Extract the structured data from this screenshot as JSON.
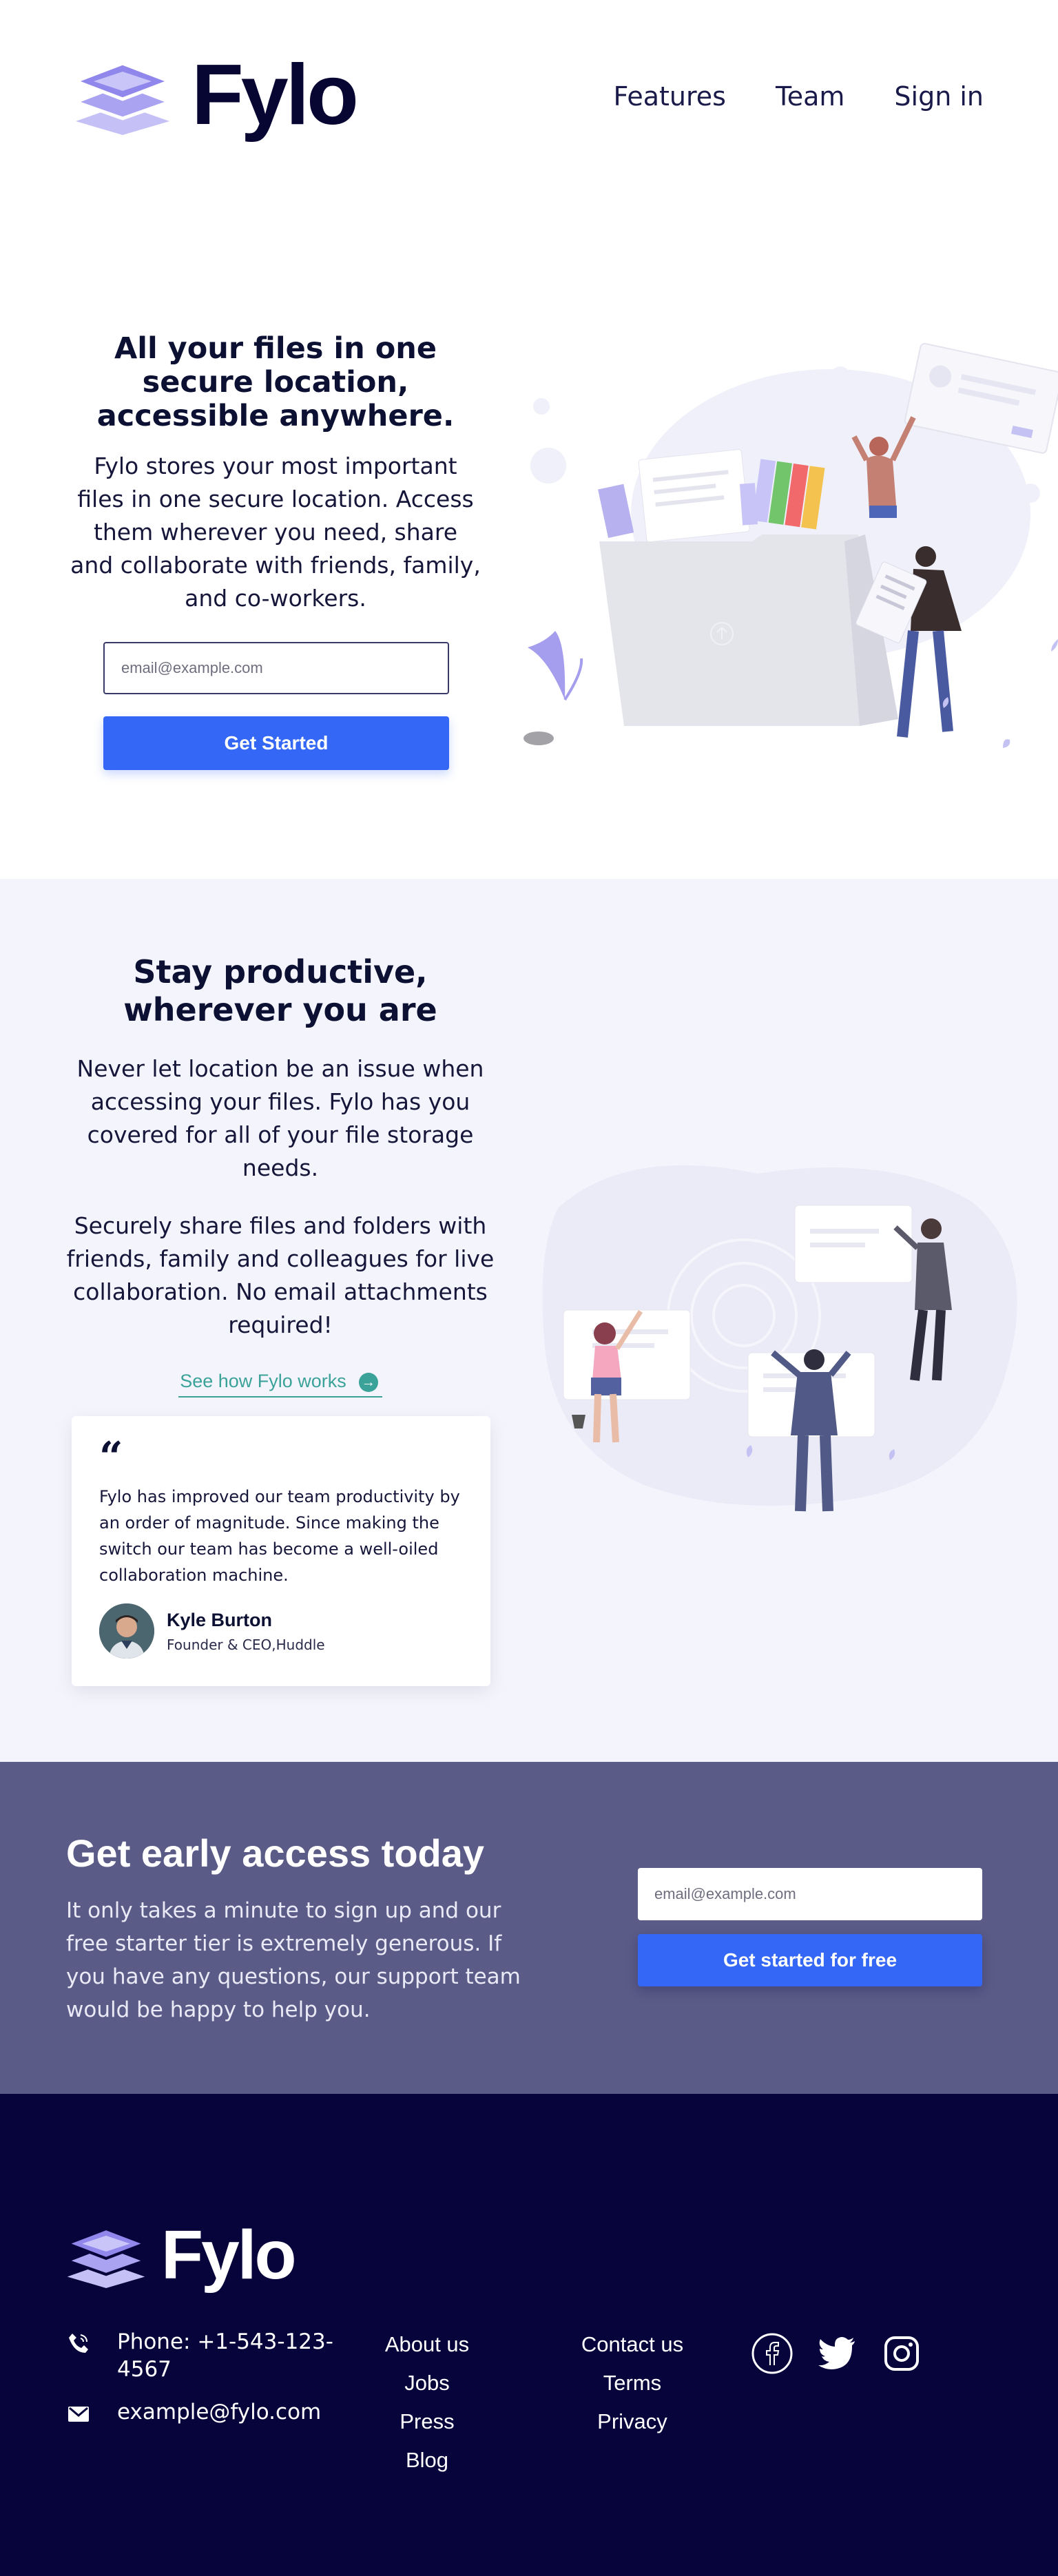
{
  "brand": {
    "name": "Fylo",
    "accent": "#3467f6",
    "link_color": "#3ba29a",
    "dark_navy": "#07043b",
    "muted_purple": "#5b5b88"
  },
  "nav": {
    "items": [
      "Features",
      "Team",
      "Sign in"
    ]
  },
  "hero": {
    "title": "All your files in one secure location, accessible anywhere.",
    "description": "Fylo stores your most important files in one secure location. Access them wherever you need, share and collaborate with friends, family, and co-workers.",
    "email_placeholder": "email@example.com",
    "cta_label": "Get Started"
  },
  "productive": {
    "title": "Stay productive, wherever you are",
    "para1": "Never let location be an issue when accessing your files. Fylo has you covered for all of your file storage needs.",
    "para2": "Securely share files and folders with friends, family and colleagues for live collaboration. No email attachments required!",
    "link_label": "See how Fylo works",
    "testimonial": {
      "quote_mark": "“",
      "text": "Fylo has improved our team productivity by an order of magnitude. Since making the switch our team has become a well-oiled collaboration machine.",
      "author": "Kyle Burton",
      "role": "Founder & CEO,Huddle"
    }
  },
  "early": {
    "title": "Get early access today",
    "description": "It only takes a minute to sign up and our free starter tier is extremely generous. If you have any questions, our support team would be happy to help you.",
    "email_placeholder": "email@example.com",
    "cta_label": "Get started for free"
  },
  "footer": {
    "phone": "Phone: +1-543-123-4567",
    "email": "example@fylo.com",
    "col1": [
      "About us",
      "Jobs",
      "Press",
      "Blog"
    ],
    "col2": [
      "Contact us",
      "Terms",
      "Privacy"
    ],
    "social": [
      "facebook-icon",
      "twitter-icon",
      "instagram-icon"
    ]
  }
}
